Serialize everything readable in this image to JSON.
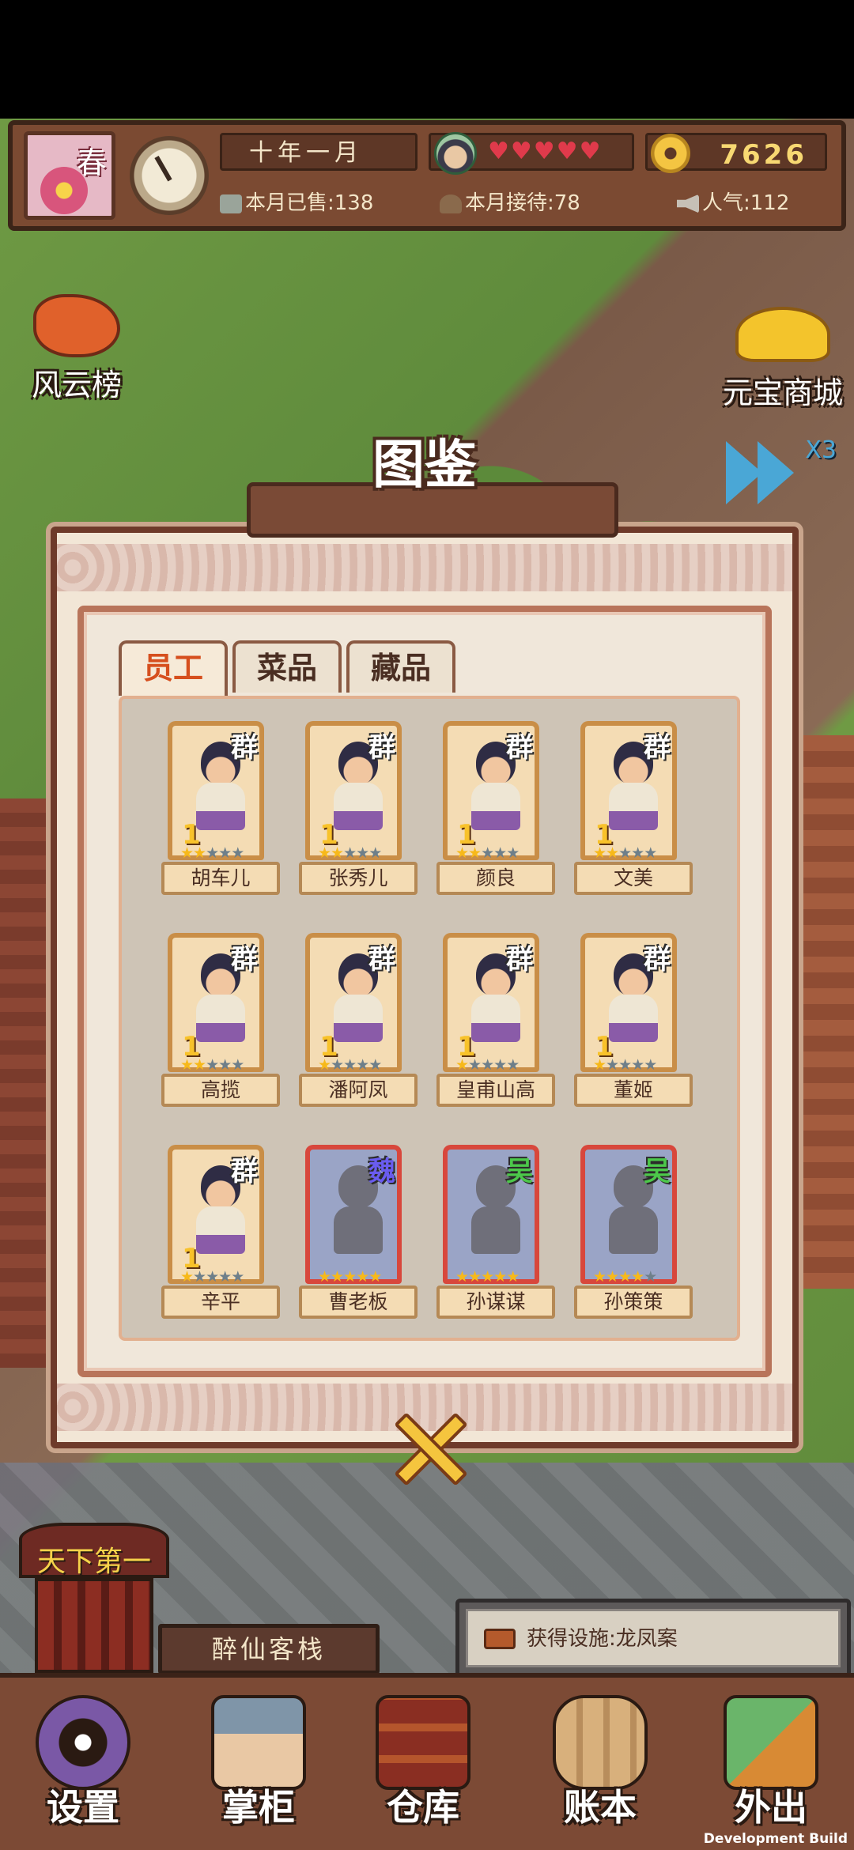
{
  "hud": {
    "season": "春",
    "date": "十年一月",
    "hearts": "♥♥♥♥♥",
    "coins": "7626",
    "sold_label": "本月已售:",
    "sold_value": "138",
    "served_label": "本月接待:",
    "served_value": "78",
    "popularity_label": "人气:",
    "popularity_value": "112"
  },
  "side": {
    "ranking_label": "风云榜",
    "shop_label": "元宝商城",
    "speed_label": "X3"
  },
  "modal": {
    "title": "图鉴",
    "tabs": [
      {
        "label": "员工",
        "active": true
      },
      {
        "label": "菜品",
        "active": false
      },
      {
        "label": "藏品",
        "active": false
      }
    ],
    "cards": [
      {
        "name": "胡车儿",
        "tag": "群",
        "level": "1",
        "stars": 2,
        "locked": false,
        "tag_color": "#ffffff"
      },
      {
        "name": "张秀儿",
        "tag": "群",
        "level": "1",
        "stars": 2,
        "locked": false,
        "tag_color": "#ffffff"
      },
      {
        "name": "颜良",
        "tag": "群",
        "level": "1",
        "stars": 2,
        "locked": false,
        "tag_color": "#ffffff"
      },
      {
        "name": "文美",
        "tag": "群",
        "level": "1",
        "stars": 2,
        "locked": false,
        "tag_color": "#ffffff"
      },
      {
        "name": "高揽",
        "tag": "群",
        "level": "1",
        "stars": 2,
        "locked": false,
        "tag_color": "#ffffff"
      },
      {
        "name": "潘阿凤",
        "tag": "群",
        "level": "1",
        "stars": 1,
        "locked": false,
        "tag_color": "#ffffff"
      },
      {
        "name": "皇甫山高",
        "tag": "群",
        "level": "1",
        "stars": 1,
        "locked": false,
        "tag_color": "#ffffff"
      },
      {
        "name": "董姬",
        "tag": "群",
        "level": "1",
        "stars": 1,
        "locked": false,
        "tag_color": "#ffffff"
      },
      {
        "name": "辛平",
        "tag": "群",
        "level": "1",
        "stars": 1,
        "locked": false,
        "tag_color": "#ffffff"
      },
      {
        "name": "曹老板",
        "tag": "魏",
        "level": "",
        "stars": 5,
        "locked": true,
        "tag_color": "#6a5cf0"
      },
      {
        "name": "孙谋谋",
        "tag": "吴",
        "level": "",
        "stars": 5,
        "locked": true,
        "tag_color": "#4cc84a"
      },
      {
        "name": "孙策策",
        "tag": "吴",
        "level": "",
        "stars": 4,
        "locked": true,
        "tag_color": "#4cc84a"
      }
    ]
  },
  "bottom": {
    "inn_banner": "天下第一",
    "inn_name": "醉仙客栈",
    "notice": "获得设施:龙凤案",
    "buttons": [
      {
        "label": "设置",
        "icon": "yin-yang-gear-icon"
      },
      {
        "label": "掌柜",
        "icon": "shopkeeper-icon"
      },
      {
        "label": "仓库",
        "icon": "chest-icon"
      },
      {
        "label": "账本",
        "icon": "scroll-icon"
      },
      {
        "label": "外出",
        "icon": "travel-icon"
      }
    ]
  },
  "footer": {
    "dev_build": "Development Build"
  }
}
